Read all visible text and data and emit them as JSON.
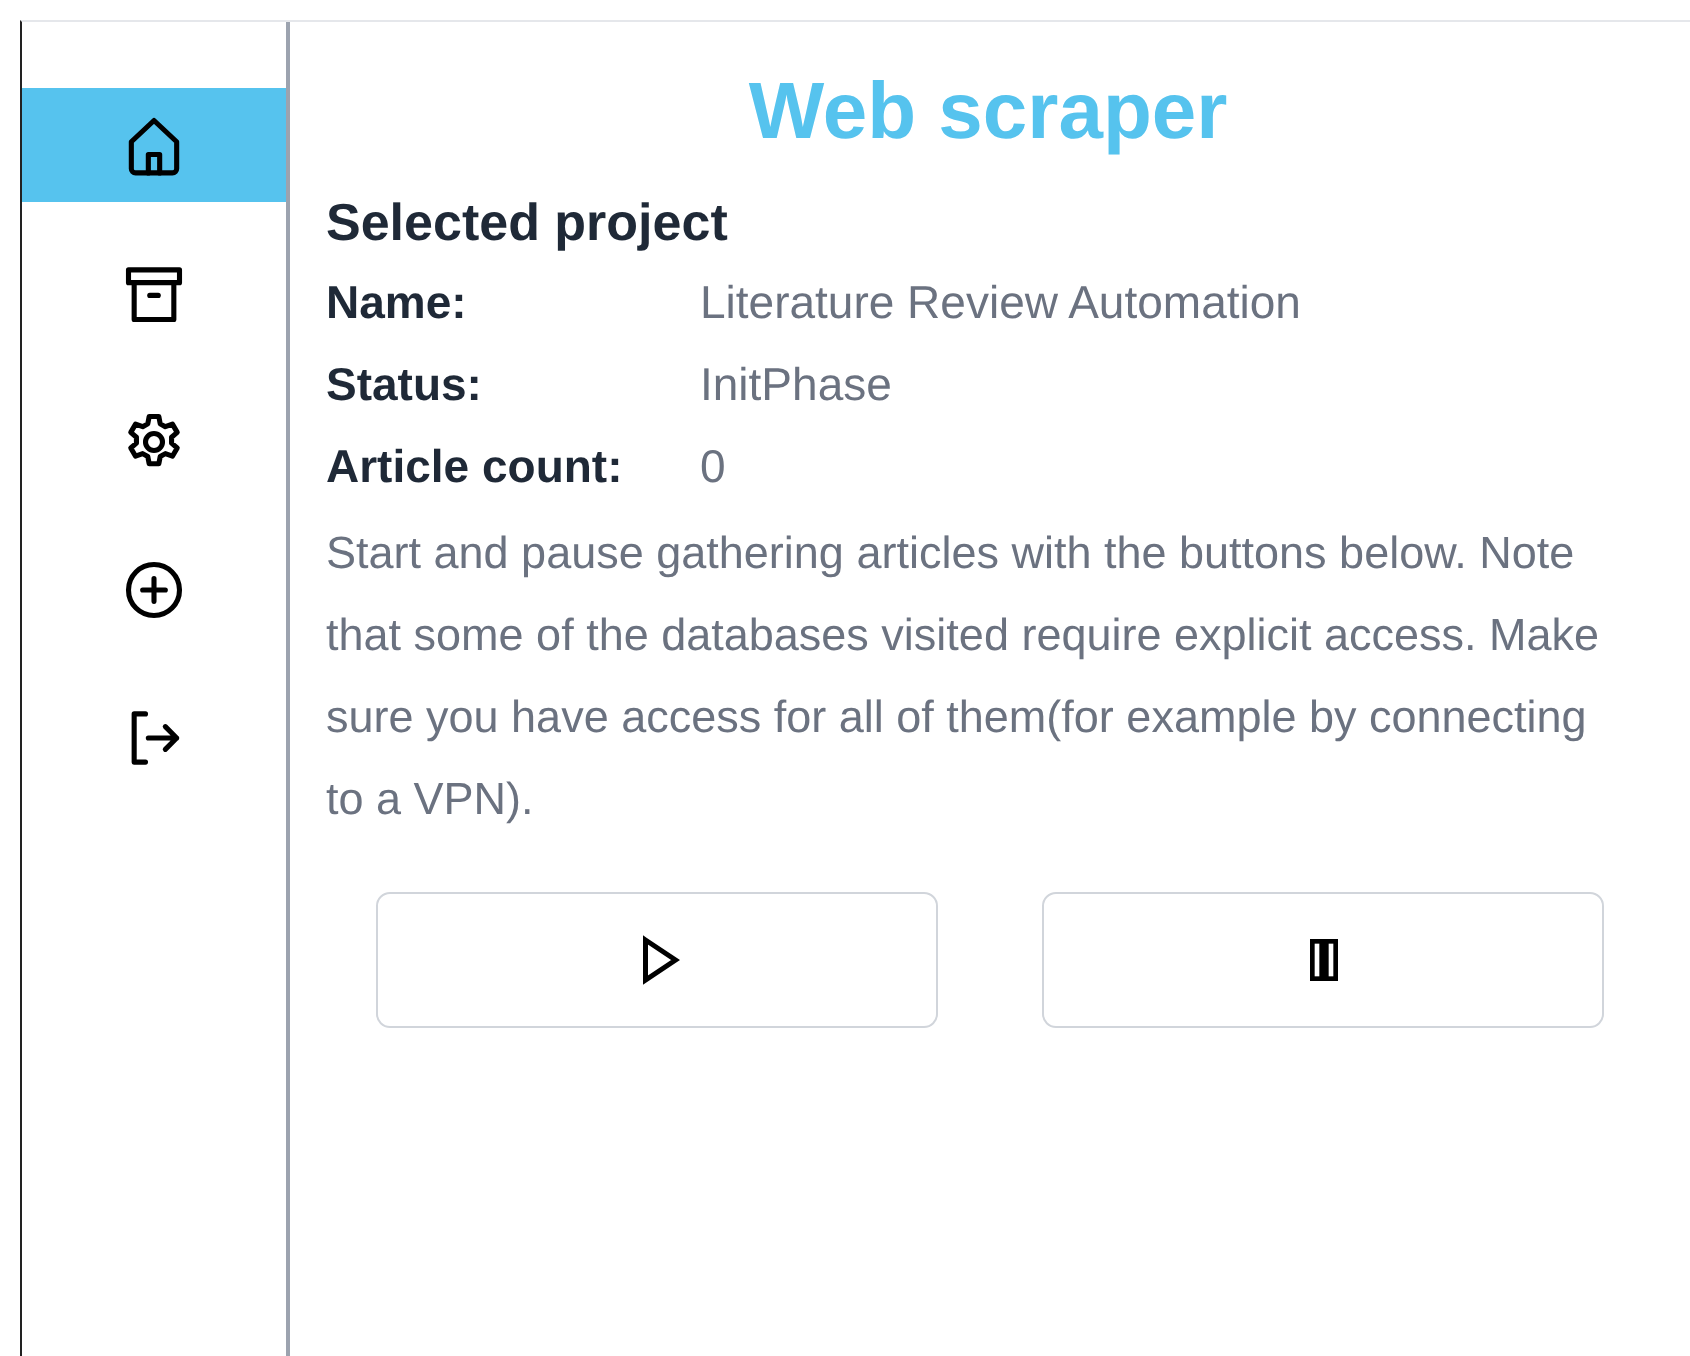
{
  "sidebar": {
    "items": [
      {
        "kind": "home",
        "selected": true
      },
      {
        "kind": "archive",
        "selected": false
      },
      {
        "kind": "settings",
        "selected": false
      },
      {
        "kind": "add",
        "selected": false
      },
      {
        "kind": "logout",
        "selected": false
      }
    ]
  },
  "title": "Web scraper",
  "project": {
    "heading": "Selected project",
    "fields": [
      {
        "label": "Name:",
        "value": "Literature Review Automation"
      },
      {
        "label": "Status:",
        "value": "InitPhase"
      },
      {
        "label": "Article count:",
        "value": "0"
      }
    ],
    "description": "Start and pause gathering articles with the buttons below. Note that some of the databases visited require explicit access. Make sure you have access for all of them(for example by connecting to a VPN)."
  },
  "buttons": [
    {
      "kind": "play"
    },
    {
      "kind": "pause"
    }
  ]
}
